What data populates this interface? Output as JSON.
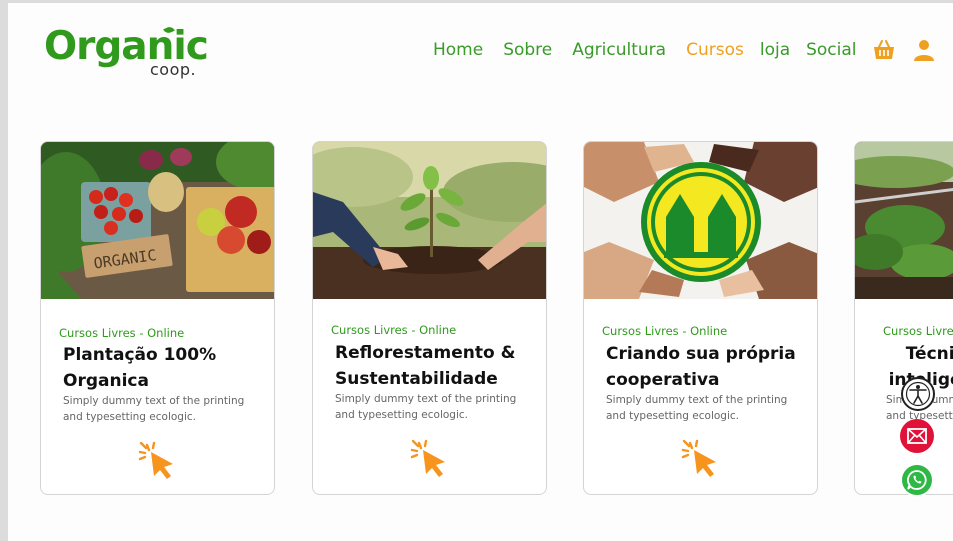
{
  "brand": {
    "logo_main": "Organic",
    "logo_sub": "coop.",
    "green": "#2f9a1c",
    "orange": "#f0a020"
  },
  "nav": {
    "items": [
      {
        "label": "Home"
      },
      {
        "label": "Sobre"
      },
      {
        "label": "Agricultura"
      },
      {
        "label": "Cursos",
        "active": true
      },
      {
        "label": "loja"
      },
      {
        "label": "Social"
      }
    ],
    "icons": [
      "basket-icon",
      "user-icon"
    ]
  },
  "cards": [
    {
      "category": "Cursos Livres - Online",
      "title": "Plantação 100% Organica",
      "description": "Simply dummy text of the printing and typesetting ecologic.",
      "image_label": "ORGANIC"
    },
    {
      "category": "Cursos Livres - Online",
      "title": "Reflorestamento & Sustentabilidade",
      "description": "Simply dummy text of the printing and typesetting ecologic."
    },
    {
      "category": "Cursos Livres - Online",
      "title": "Criando sua própria cooperativa",
      "description": "Simply dummy text of the printing and typesetting ecologic."
    },
    {
      "category": "Cursos Livres - Online",
      "title": "Técnicas inteligentes",
      "description": "Simply dummy text of the printing and typesetting ecologic."
    }
  ],
  "floating": [
    "accessibility-icon",
    "email-icon",
    "whatsapp-icon"
  ]
}
